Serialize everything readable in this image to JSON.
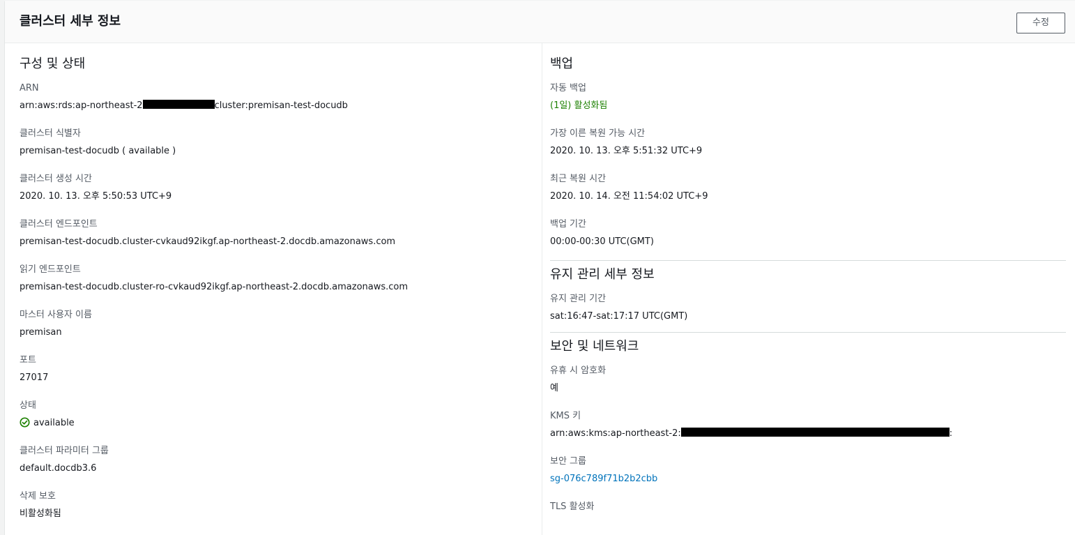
{
  "header": {
    "title": "클러스터 세부 정보",
    "edit_label": "수정"
  },
  "config": {
    "title": "구성 및 상태",
    "arn_label": "ARN",
    "arn_prefix": "arn:aws:rds:ap-northeast-2",
    "arn_suffix": "cluster:premisan-test-docudb",
    "identifier_label": "클러스터 식별자",
    "identifier_value": "premisan-test-docudb ( available )",
    "created_label": "클러스터 생성 시간",
    "created_value": "2020. 10. 13. 오후 5:50:53 UTC+9",
    "endpoint_label": "클러스터 엔드포인트",
    "endpoint_value": "premisan-test-docudb.cluster-cvkaud92ikgf.ap-northeast-2.docdb.amazonaws.com",
    "reader_label": "읽기 엔드포인트",
    "reader_value": "premisan-test-docudb.cluster-ro-cvkaud92ikgf.ap-northeast-2.docdb.amazonaws.com",
    "master_label": "마스터 사용자 이름",
    "master_value": "premisan",
    "port_label": "포트",
    "port_value": "27017",
    "status_label": "상태",
    "status_value": "available",
    "param_label": "클러스터 파라미터 그룹",
    "param_value": "default.docdb3.6",
    "deletion_label": "삭제 보호",
    "deletion_value": "비활성화됨"
  },
  "backup": {
    "title": "백업",
    "auto_label": "자동 백업",
    "auto_value": "(1일) 활성화됨",
    "earliest_label": "가장 이른 복원 가능 시간",
    "earliest_value": "2020. 10. 13. 오후 5:51:32 UTC+9",
    "latest_label": "최근 복원 시간",
    "latest_value": "2020. 10. 14. 오전 11:54:02 UTC+9",
    "window_label": "백업 기간",
    "window_value": "00:00-00:30 UTC(GMT)"
  },
  "maintenance": {
    "title": "유지 관리 세부 정보",
    "window_label": "유지 관리 기간",
    "window_value": "sat:16:47-sat:17:17 UTC(GMT)"
  },
  "security": {
    "title": "보안 및 네트워크",
    "encryption_label": "유휴 시 암호화",
    "encryption_value": "예",
    "kms_label": "KMS 키",
    "kms_prefix": "arn:aws:kms:ap-northeast-2:",
    "kms_suffix": ":",
    "sg_label": "보안 그룹",
    "sg_value": "sg-076c789f71b2b2cbb",
    "tls_label": "TLS 활성화"
  },
  "colors": {
    "success": "#1d8102",
    "link": "#0073bb"
  }
}
